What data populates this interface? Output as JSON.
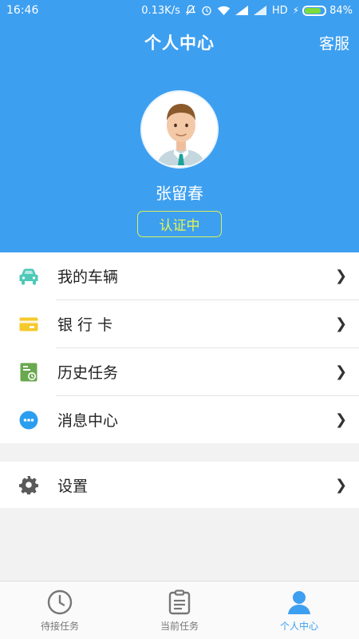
{
  "status_bar": {
    "time": "16:46",
    "network_speed": "0.13K/s",
    "network_type": "HD",
    "battery_text": "84%",
    "battery_level": 0.84
  },
  "header": {
    "title": "个人中心",
    "service_label": "客服"
  },
  "profile": {
    "name": "张留春",
    "status_label": "认证中"
  },
  "menu": [
    {
      "label": "我的车辆",
      "icon": "car-icon"
    },
    {
      "label": "银 行 卡",
      "icon": "bank-card-icon"
    },
    {
      "label": "历史任务",
      "icon": "history-task-icon"
    },
    {
      "label": "消息中心",
      "icon": "message-icon"
    }
  ],
  "settings": {
    "label": "设置",
    "icon": "gear-icon"
  },
  "tabs": [
    {
      "label": "待接任务",
      "icon": "clock-icon",
      "active": false
    },
    {
      "label": "当前任务",
      "icon": "clipboard-icon",
      "active": false
    },
    {
      "label": "个人中心",
      "icon": "person-icon",
      "active": true
    }
  ],
  "colors": {
    "primary": "#3d9ff0",
    "badge_yellow": "#e8f54f",
    "car_teal": "#4ec9b8",
    "card_yellow": "#f5c82c",
    "history_green": "#6aa84f",
    "message_blue": "#2b9ef0",
    "gear_gray": "#5a5a5a"
  }
}
